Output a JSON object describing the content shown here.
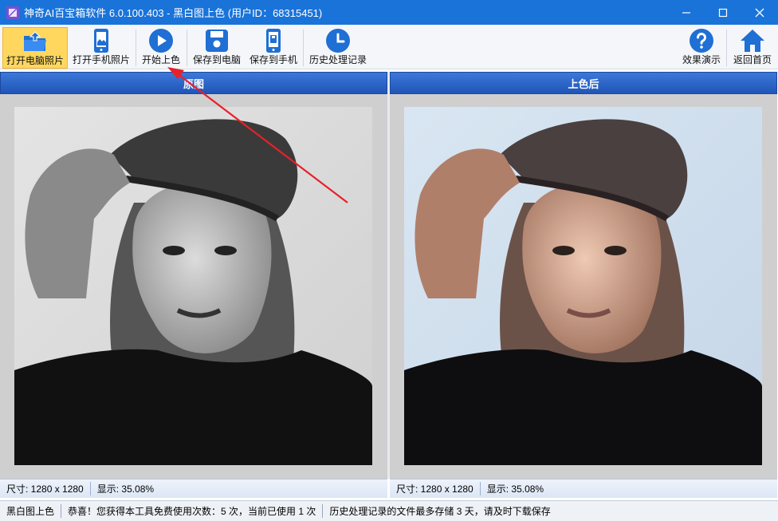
{
  "window": {
    "title": "神奇AI百宝箱软件 6.0.100.403 - 黑白图上色 (用户ID：68315451)"
  },
  "toolbar": {
    "open_pc": "打开电脑照片",
    "open_phone": "打开手机照片",
    "start_color": "开始上色",
    "save_pc": "保存到电脑",
    "save_phone": "保存到手机",
    "history": "历史处理记录",
    "demo": "效果演示",
    "home": "返回首页"
  },
  "panels": {
    "left": {
      "header": "原图",
      "size_text": "尺寸: 1280 x 1280",
      "zoom_text": "显示: 35.08%"
    },
    "right": {
      "header": "上色后",
      "size_text": "尺寸: 1280 x 1280",
      "zoom_text": "显示: 35.08%"
    }
  },
  "statusbar": {
    "module": "黑白图上色",
    "usage": "恭喜！您获得本工具免费使用次数：5 次，当前已使用 1 次",
    "notice": "历史处理记录的文件最多存储 3 天，请及时下载保存"
  },
  "colors": {
    "titlebar": "#1a73d9",
    "toolbar_icon": "#1f6fd4",
    "panel_header": "#2a62c6",
    "arrow": "#e8202a"
  }
}
